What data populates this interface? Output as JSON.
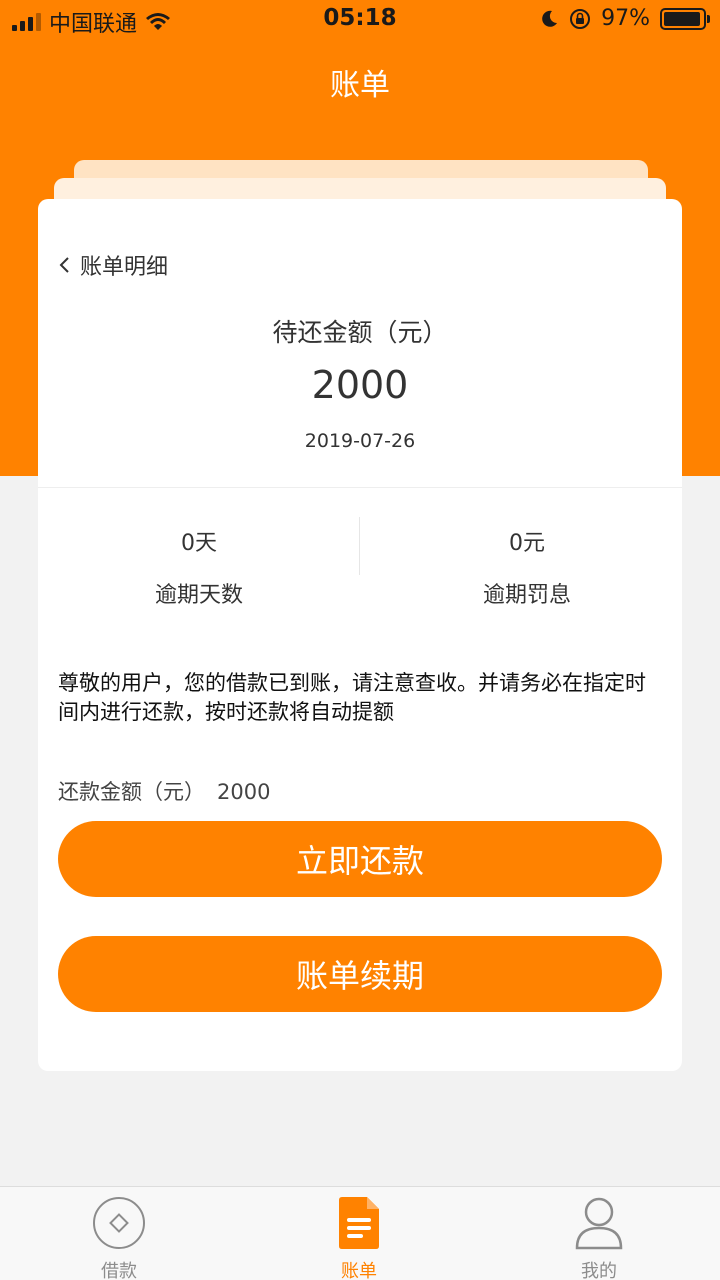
{
  "status_bar": {
    "carrier": "中国联通",
    "time": "05:18",
    "battery": "97%"
  },
  "header": {
    "title": "账单"
  },
  "card": {
    "back_label": "账单明细",
    "amount_label": "待还金额（元）",
    "amount_value": "2000",
    "due_date": "2019-07-26",
    "overdue_days": {
      "value": "0天",
      "label": "逾期天数"
    },
    "overdue_penalty": {
      "value": "0元",
      "label": "逾期罚息"
    },
    "notice": "尊敬的用户，您的借款已到账，请注意查收。并请务必在指定时间内进行还款，按时还款将自动提额",
    "repay_amount_label": "还款金额（元）",
    "repay_amount_value": "2000",
    "repay_button": "立即还款",
    "renew_button": "账单续期"
  },
  "tabbar": {
    "items": [
      {
        "label": "借款",
        "icon": "diamond-circle-icon",
        "active": false
      },
      {
        "label": "账单",
        "icon": "document-icon",
        "active": true
      },
      {
        "label": "我的",
        "icon": "person-icon",
        "active": false
      }
    ]
  },
  "colors": {
    "accent": "#ff8200",
    "background": "#f2f2f2",
    "card": "#ffffff",
    "tab_inactive": "#8c8c8c"
  }
}
